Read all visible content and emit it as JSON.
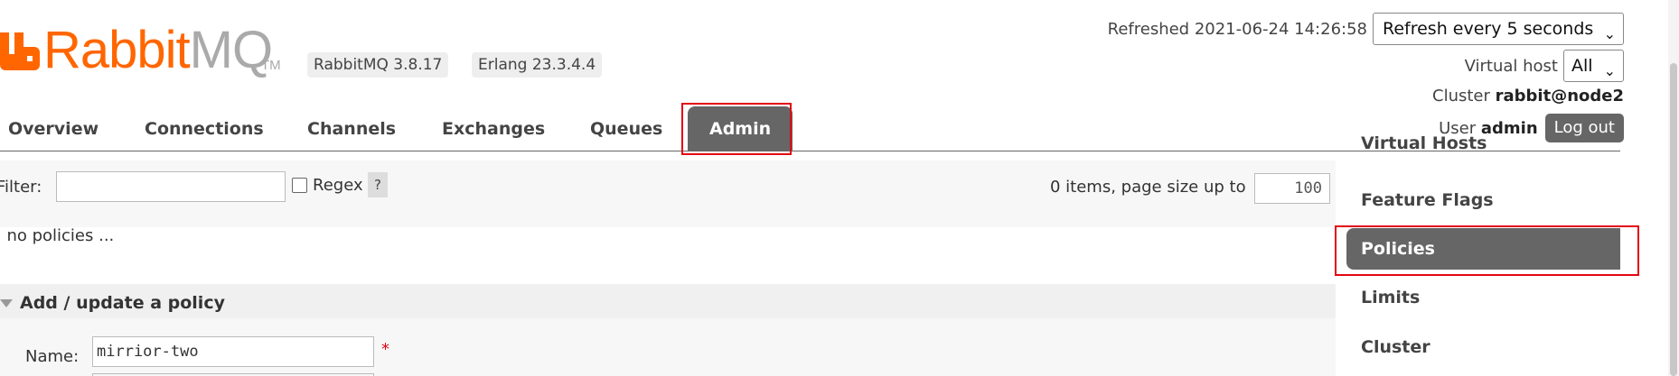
{
  "header": {
    "logo_rabbit": "Rabbit",
    "logo_mq": "MQ",
    "logo_tm": "TM",
    "rabbitmq_version": "RabbitMQ 3.8.17",
    "erlang_version": "Erlang 23.3.4.4",
    "brand_color": "#ff6600"
  },
  "status": {
    "refreshed": "Refreshed 2021-06-24 14:26:58",
    "refresh_select": "Refresh every 5 seconds",
    "vhost_label": "Virtual host",
    "vhost_select": "All",
    "cluster_label": "Cluster",
    "cluster_value": "rabbit@node2",
    "user_label": "User",
    "user_value": "admin",
    "logout_label": "Log out"
  },
  "nav": {
    "tabs": [
      "Overview",
      "Connections",
      "Channels",
      "Exchanges",
      "Queues",
      "Admin"
    ],
    "active_tab": "Admin"
  },
  "policies": {
    "filter_label": "Filter:",
    "filter_value": "",
    "regex_label": "Regex",
    "help_label": "?",
    "items_text": "0 items, page size up to",
    "page_size": "100",
    "empty_text": ". no policies ..."
  },
  "add_policy": {
    "title": "Add / update a policy",
    "name_label": "Name:",
    "name_value": "mirrior-two",
    "required_mark": "*"
  },
  "subnav": {
    "items": [
      "Virtual Hosts",
      "Feature Flags",
      "Policies",
      "Limits",
      "Cluster"
    ],
    "active": "Policies"
  },
  "accent_colors": {
    "highlight": "#e30613",
    "active_tab": "#666666"
  }
}
